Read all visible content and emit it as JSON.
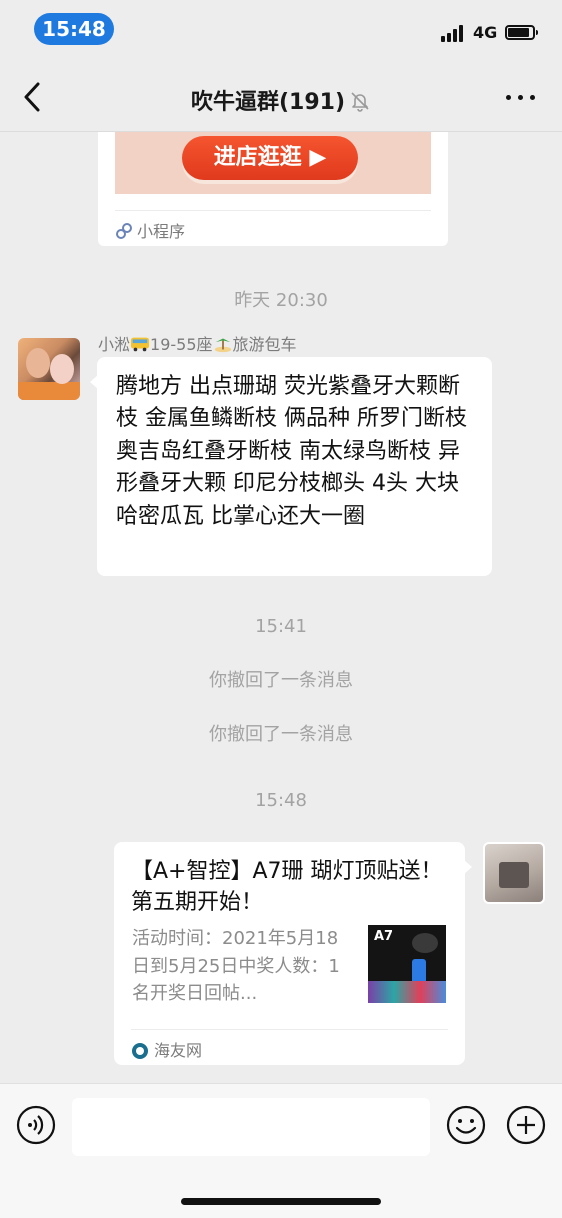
{
  "status_bar": {
    "time": "15:48",
    "network": "4G"
  },
  "nav": {
    "title": "吹牛逼群(191)",
    "back_icon": "chevron-left-icon",
    "mute_icon": "bell-slash-icon",
    "more_icon": "ellipsis-icon"
  },
  "mini_program_card": {
    "banner_button": "进店逛逛 ▶",
    "source_label": "小程序"
  },
  "timestamps": {
    "t1": "昨天 20:30",
    "t2": "15:41",
    "t3": "15:48"
  },
  "received_message": {
    "sender_name_prefix": "小淞",
    "sender_name_middle": "19-55座",
    "sender_name_suffix": "旅游包车",
    "text": "腾地方 出点珊瑚 荧光紫叠牙大颗断枝 金属鱼鳞断枝 俩品种 所罗门断枝 奥吉岛红叠牙断枝 南太绿鸟断枝 异形叠牙大颗 印尼分枝榔头 4头 大块哈密瓜瓦 比掌心还大一圈"
  },
  "system_messages": {
    "recall_1": "你撤回了一条消息",
    "recall_2": "你撤回了一条消息"
  },
  "sent_link_card": {
    "title": "【A+智控】A7珊 瑚灯顶贴送！第五期开始！",
    "description": "活动时间：2021年5月18日到5月25日中奖人数：1名开奖日回帖...",
    "thumbnail_text": "A7",
    "source": "海友网"
  },
  "input_bar": {
    "text_value": "",
    "voice_icon": "voice-icon",
    "emoji_icon": "emoji-icon",
    "plus_icon": "plus-icon"
  },
  "colors": {
    "background": "#ededed",
    "time_pill": "#1f7ae0",
    "bubble": "#ffffff",
    "timestamp_text": "#a3a3a3",
    "banner_button": "#e8452a"
  }
}
